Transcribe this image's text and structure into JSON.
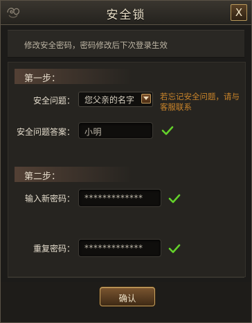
{
  "window": {
    "title": "安全锁",
    "close_label": "X"
  },
  "description": "修改安全密码，密码修改后下次登录生效",
  "step1": {
    "title": "第一步：",
    "question_label": "安全问题：",
    "question_value": "您父亲的名字",
    "hint": "若忘记安全问题，请与客服联系",
    "answer_label": "安全问题答案：",
    "answer_value": "小明"
  },
  "step2": {
    "title": "第二步：",
    "new_password_label": "输入新密码：",
    "new_password_value": "*************",
    "repeat_password_label": "重复密码：",
    "repeat_password_value": "*************"
  },
  "footer": {
    "confirm_label": "确认"
  },
  "icons": {
    "valid": "check-icon",
    "dropdown": "chevron-down-icon",
    "ornament": "ornament-icon"
  },
  "colors": {
    "check": "#63d12a",
    "hint": "#c9842a",
    "title_text": "#e9dfc8"
  }
}
